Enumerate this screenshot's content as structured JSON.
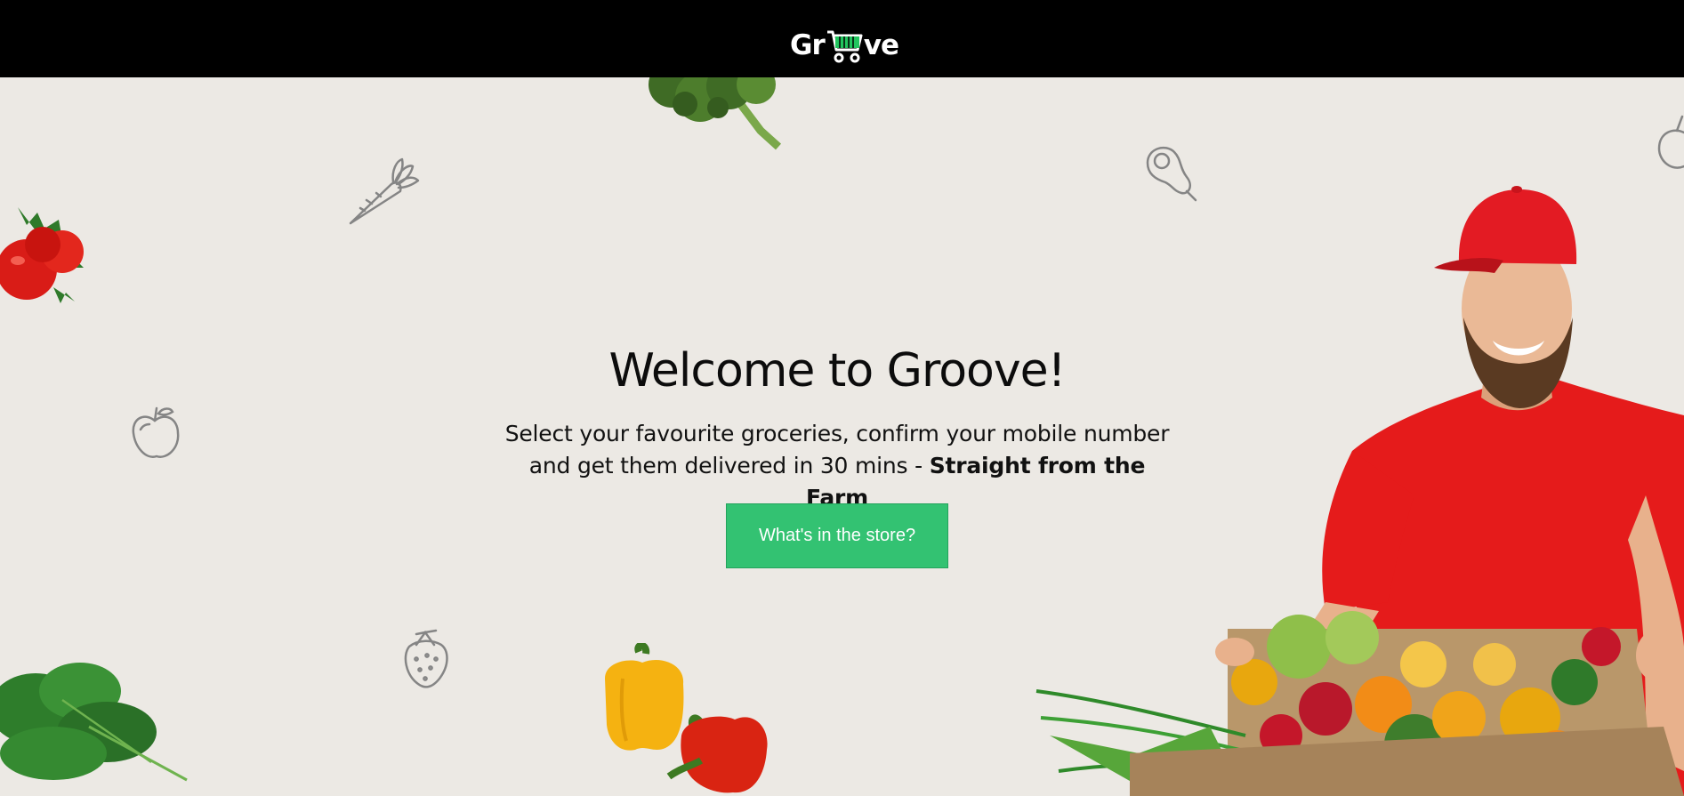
{
  "header": {
    "logo_prefix": "Gr",
    "logo_suffix": "ve",
    "logo_alt": "Groove"
  },
  "hero": {
    "title": "Welcome to Groove!",
    "subtitle_line1": "Select your favourite groceries, confirm your mobile number",
    "subtitle_line2": "and get them delivered in 30 mins - ",
    "subtitle_bold": "Straight from the Farm",
    "cta_label": "What's in the store?"
  },
  "colors": {
    "topbar": "#000000",
    "background": "#ece9e4",
    "accent": "#33c272",
    "logo_cart": "#22c55e"
  },
  "icons": [
    "carrot-outline-icon",
    "pear-outline-icon",
    "apple-outline-icon",
    "strawberry-outline-icon",
    "shopping-cart-icon"
  ]
}
